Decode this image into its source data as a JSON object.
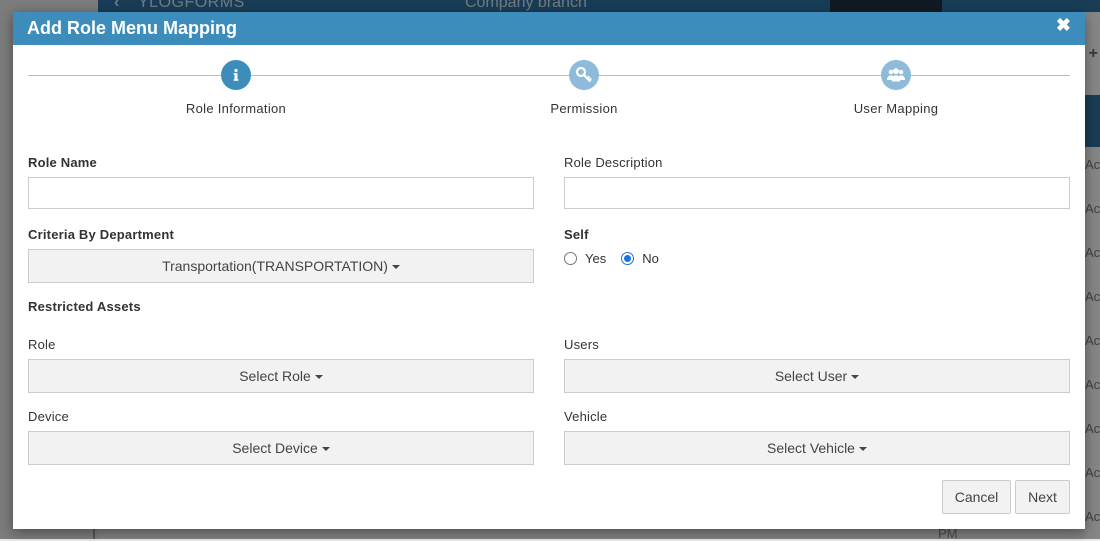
{
  "background": {
    "brand": "YLOGFORMS",
    "center_title": "Company branch",
    "right_cells": [
      "Ac",
      "Ac",
      "Ac",
      "Ac",
      "Ac",
      "Ac",
      "Ac",
      "Ac",
      "Ac",
      "Ac"
    ],
    "pm_label": "PM",
    "header_partial": "S"
  },
  "modal": {
    "title": "Add Role Menu Mapping",
    "close_icon": "close-icon",
    "steps": [
      {
        "label": "Role Information",
        "icon": "info-icon",
        "state": "active"
      },
      {
        "label": "Permission",
        "icon": "key-icon",
        "state": "inactive"
      },
      {
        "label": "User Mapping",
        "icon": "users-icon",
        "state": "inactive"
      }
    ]
  },
  "form": {
    "role_name": {
      "label": "Role Name",
      "value": ""
    },
    "role_description": {
      "label": "Role Description",
      "value": ""
    },
    "criteria_department": {
      "label": "Criteria By Department",
      "selected": "Transportation(TRANSPORTATION)"
    },
    "self": {
      "label": "Self",
      "options": [
        "Yes",
        "No"
      ],
      "selected": "No"
    },
    "restricted_assets_heading": "Restricted Assets",
    "role": {
      "label": "Role",
      "selected": "Select Role"
    },
    "users": {
      "label": "Users",
      "selected": "Select User"
    },
    "device": {
      "label": "Device",
      "selected": "Select Device"
    },
    "vehicle": {
      "label": "Vehicle",
      "selected": "Select Vehicle"
    }
  },
  "footer": {
    "cancel_label": "Cancel",
    "next_label": "Next"
  },
  "colors": {
    "header": "#3c8dbc",
    "step_active": "#3c8dbc",
    "step_inactive": "#8dbbd9",
    "radio_checked": "#1a73e8"
  }
}
